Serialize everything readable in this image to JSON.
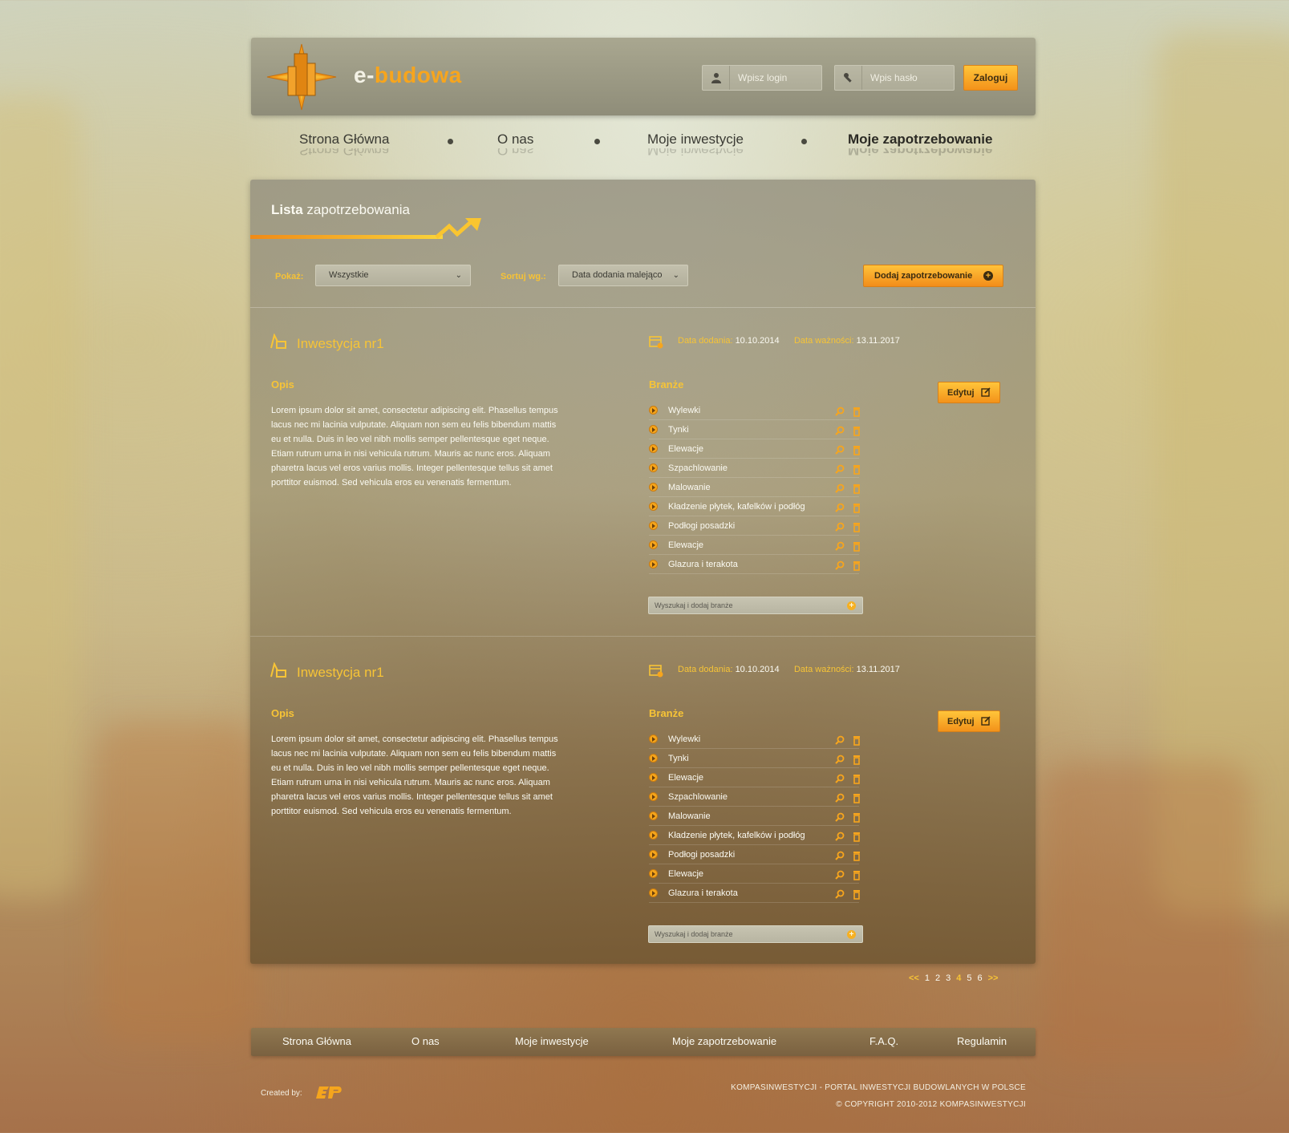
{
  "header": {
    "brand_prefix": "e-",
    "brand_name": "budowa",
    "login_placeholder": "Wpisz login",
    "password_placeholder": "Wpis hasło",
    "login_button": "Zaloguj"
  },
  "nav": {
    "items": [
      {
        "label": "Strona Główna"
      },
      {
        "label": "O nas"
      },
      {
        "label": "Moje inwestycje"
      },
      {
        "label": "Moje zapotrzebowanie"
      }
    ]
  },
  "panel": {
    "title_bold": "Lista",
    "title_rest": "zapotrzebowania",
    "filter_label": "Pokaż:",
    "filter_value": "Wszystkie",
    "sort_label": "Sortuj wg.:",
    "sort_value": "Data dodania malejąco",
    "add_button": "Dodaj zapotrzebowanie"
  },
  "investments": [
    {
      "title": "Inwestycja nr1",
      "added_label": "Data dodania:",
      "added_value": "10.10.2014",
      "valid_label": "Data ważności:",
      "valid_value": "13.11.2017",
      "desc_heading": "Opis",
      "description": "Lorem ipsum dolor sit amet, consectetur adipiscing elit. Phasellus tempus lacus nec mi lacinia vulputate. Aliquam non sem eu felis bibendum mattis eu et nulla. Duis in leo vel nibh mollis semper pellentesque eget neque. Etiam rutrum urna in nisi vehicula rutrum. Mauris ac nunc eros. Aliquam pharetra lacus vel eros varius mollis. Integer pellentesque tellus sit amet porttitor euismod. Sed vehicula eros eu venenatis fermentum.",
      "branze_heading": "Branże",
      "edit_button": "Edytuj",
      "branze": [
        "Wylewki",
        "Tynki",
        "Elewacje",
        "Szpachlowanie",
        "Malowanie",
        "Kładzenie płytek, kafelków i podłóg",
        "Podłogi posadzki",
        "Elewacje",
        "Glazura i terakota"
      ],
      "search_placeholder": "Wyszukaj i dodaj branże"
    },
    {
      "title": "Inwestycja nr1",
      "added_label": "Data dodania:",
      "added_value": "10.10.2014",
      "valid_label": "Data ważności:",
      "valid_value": "13.11.2017",
      "desc_heading": "Opis",
      "description": "Lorem ipsum dolor sit amet, consectetur adipiscing elit. Phasellus tempus lacus nec mi lacinia vulputate. Aliquam non sem eu felis bibendum mattis eu et nulla. Duis in leo vel nibh mollis semper pellentesque eget neque. Etiam rutrum urna in nisi vehicula rutrum. Mauris ac nunc eros. Aliquam pharetra lacus vel eros varius mollis. Integer pellentesque tellus sit amet porttitor euismod. Sed vehicula eros eu venenatis fermentum.",
      "branze_heading": "Branże",
      "edit_button": "Edytuj",
      "branze": [
        "Wylewki",
        "Tynki",
        "Elewacje",
        "Szpachlowanie",
        "Malowanie",
        "Kładzenie płytek, kafelków i podłóg",
        "Podłogi posadzki",
        "Elewacje",
        "Glazura i terakota"
      ],
      "search_placeholder": "Wyszukaj i dodaj branże"
    }
  ],
  "pagination": {
    "prev": "<<",
    "pages": [
      "1",
      "2",
      "3",
      "4",
      "5",
      "6"
    ],
    "current": "4",
    "next": ">>"
  },
  "footer": {
    "nav": [
      "Strona Główna",
      "O nas",
      "Moje inwestycje",
      "Moje zapotrzebowanie",
      "F.A.Q.",
      "Regulamin"
    ],
    "created_by": "Created by:",
    "line1": "KOMPASINWESTYCJI - PORTAL INWESTYCJI BUDOWLANYCH W POLSCE",
    "line2": "© COPYRIGHT 2010-2012 KOMPASINWESTYCJI"
  },
  "colors": {
    "accent": "#f7a51d",
    "accent_text": "#f7c436",
    "text_light": "#fbfaf2"
  }
}
